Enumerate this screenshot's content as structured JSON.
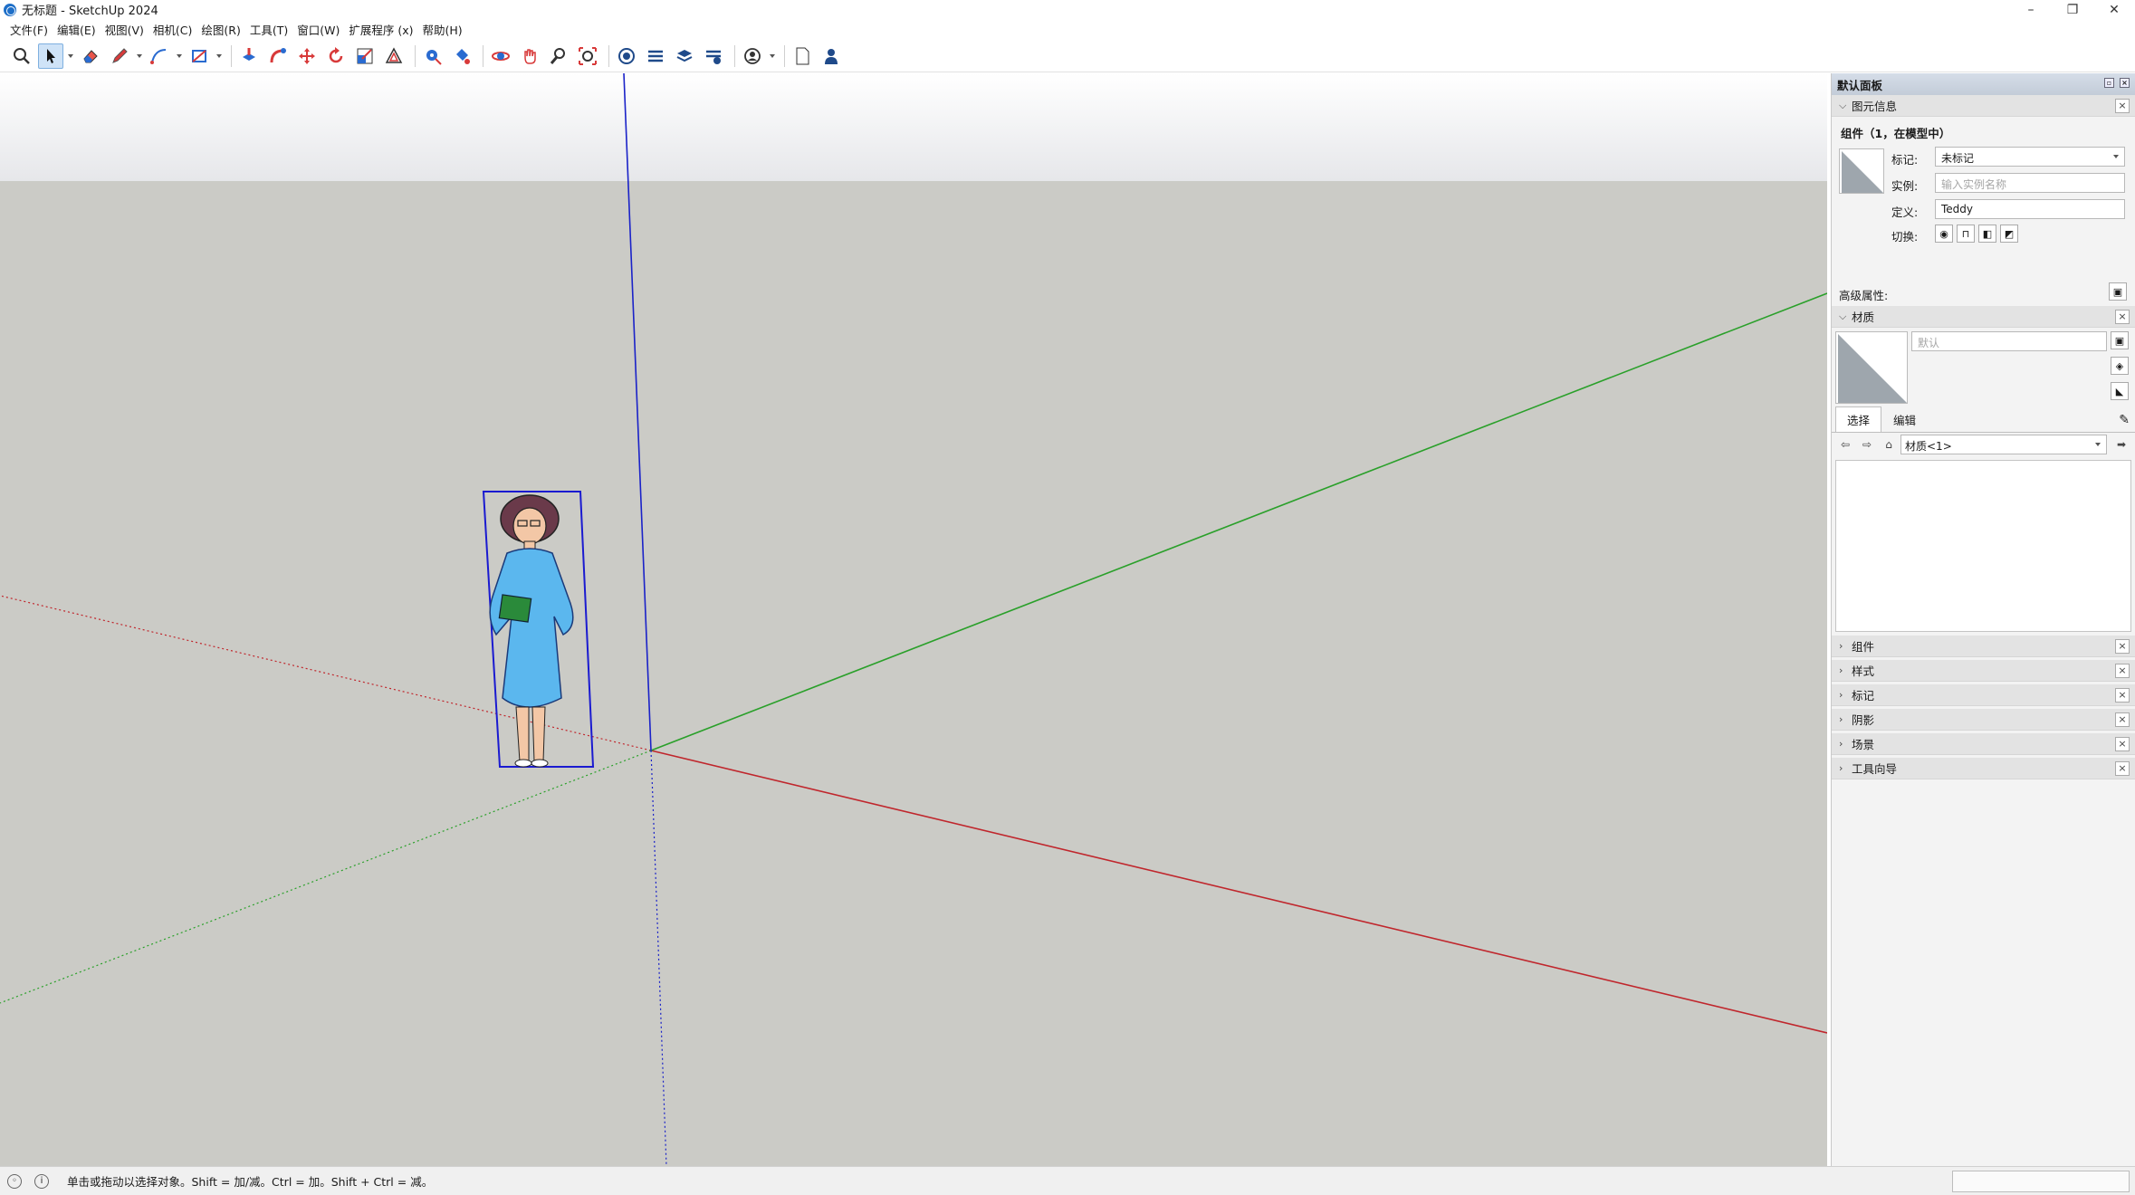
{
  "window": {
    "title": "无标题 - SketchUp 2024",
    "minimize": "–",
    "restore": "❐",
    "close": "✕"
  },
  "menu": [
    "文件(F)",
    "编辑(E)",
    "视图(V)",
    "相机(C)",
    "绘图(R)",
    "工具(T)",
    "窗口(W)",
    "扩展程序 (x)",
    "帮助(H)"
  ],
  "toolbar": {
    "tools": [
      "search-icon",
      "select-icon",
      "eraser-icon",
      "pencil-icon",
      "line-icon",
      "rectangle-icon",
      "push-pull-icon",
      "follow-me-icon",
      "move-icon",
      "rotate-icon",
      "scale-icon",
      "offset-icon",
      "tape-measure-icon",
      "paint-bucket-icon",
      "orbit-icon",
      "pan-icon",
      "zoom-icon",
      "zoom-extents-icon",
      "warehouse-icon",
      "extension-warehouse-icon",
      "layout-icon",
      "extension-manager-icon",
      "account-icon",
      "new-document-icon",
      "user-icon"
    ],
    "active_tool": "select-icon"
  },
  "viewport": {
    "sky_color": "#e8e9ec",
    "ground_color": "#cbcbc6",
    "axis_colors": {
      "red": "#c0262c",
      "green": "#2aa02a",
      "blue": "#1a22c8"
    }
  },
  "tray": {
    "title": "默认面板",
    "entity_info": {
      "section_title": "图元信息",
      "heading": "组件（1，在模型中）",
      "tag_label": "标记:",
      "tag_value": "未标记",
      "instance_label": "实例:",
      "instance_placeholder": "输入实例名称",
      "definition_label": "定义:",
      "definition_value": "Teddy",
      "toggle_label": "切换:",
      "advanced_label": "高级属性:"
    },
    "materials": {
      "section_title": "材质",
      "name_placeholder": "默认",
      "tab_select": "选择",
      "tab_edit": "编辑",
      "collection": "材质<1>"
    },
    "collapsed_sections": [
      "组件",
      "样式",
      "标记",
      "阴影",
      "场景",
      "工具向导"
    ]
  },
  "status": {
    "text": "单击或拖动以选择对象。Shift = 加/减。Ctrl = 加。Shift + Ctrl = 减。"
  }
}
